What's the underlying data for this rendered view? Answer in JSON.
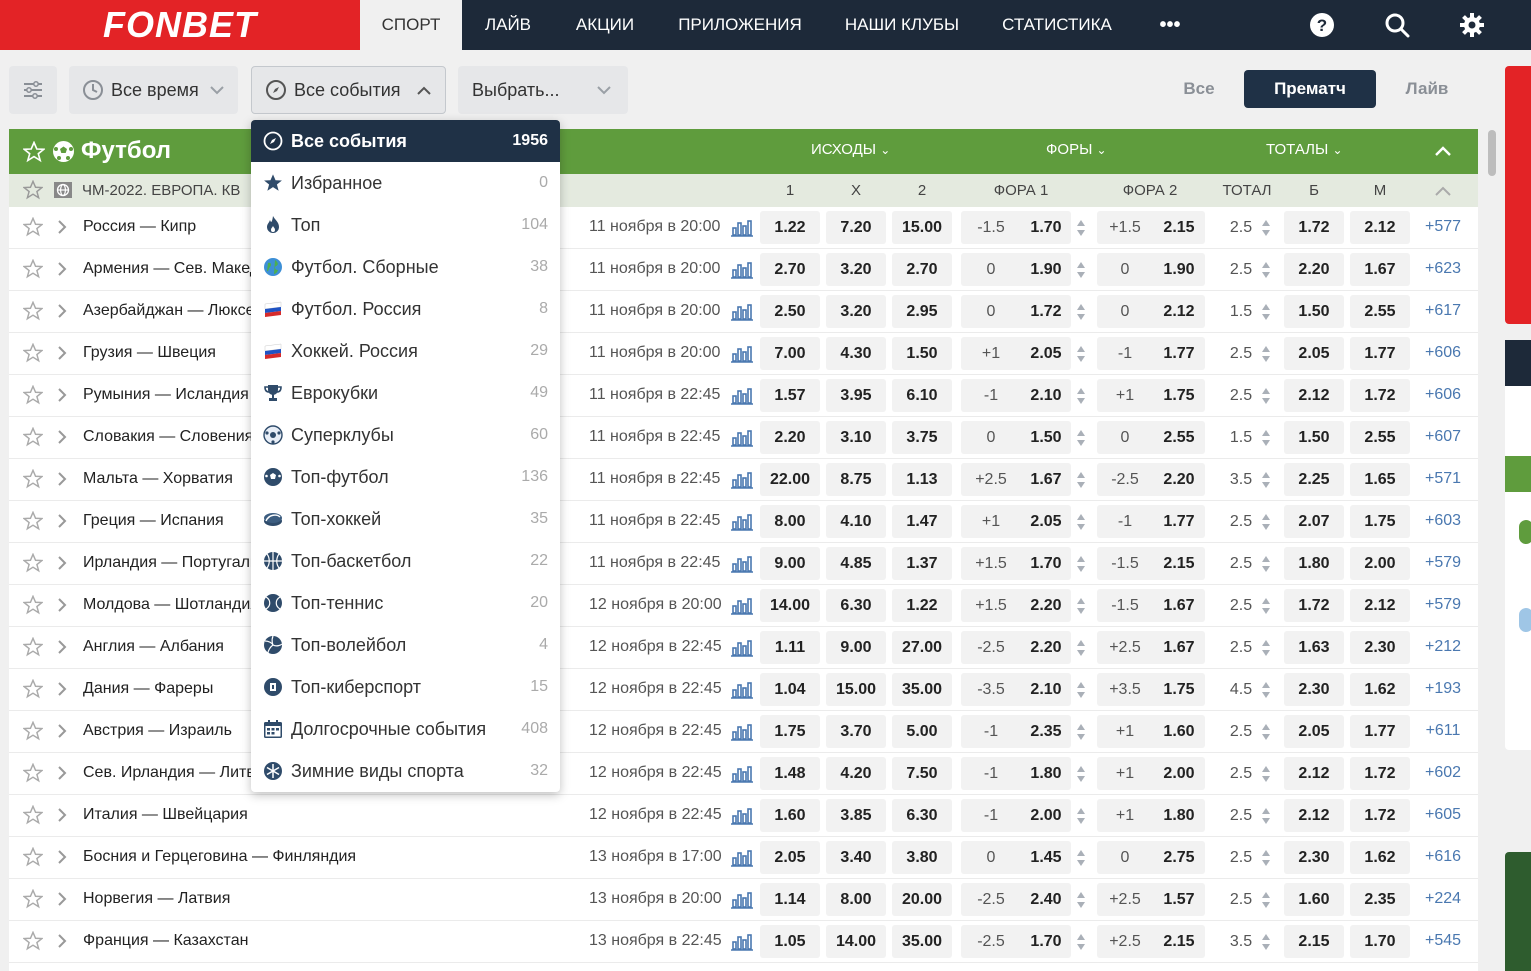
{
  "brand": {
    "logo_text": "FONBET",
    "red": "#e32326",
    "navy": "#1d2939",
    "green": "#5f9c3d"
  },
  "nav": {
    "items": [
      "СПОРТ",
      "ЛАЙВ",
      "АКЦИИ",
      "ПРИЛОЖЕНИЯ",
      "НАШИ КЛУБЫ",
      "СТАТИСТИКА",
      "•••"
    ],
    "icons": [
      "help-icon",
      "search-icon",
      "gear-icon"
    ]
  },
  "filters": {
    "time": "Все время",
    "events": "Все события",
    "select": "Выбрать..."
  },
  "modes": [
    "Все",
    "Прематч",
    "Лайв"
  ],
  "sport": {
    "title": "Футбол",
    "groups": [
      "ИСХОДЫ",
      "ФОРЫ",
      "ТОТАЛЫ"
    ],
    "league": "ЧМ-2022. ЕВРОПА. КВ",
    "columns": [
      "1",
      "Х",
      "2",
      "ФОРА 1",
      "ФОРА 2",
      "ТОТАЛ",
      "Б",
      "М"
    ]
  },
  "events": [
    {
      "name": "Россия — Кипр",
      "date": "11 ноября в 20:00",
      "o1": "1.22",
      "x": "7.20",
      "o2": "15.00",
      "h1": "-1.5",
      "h1o": "1.70",
      "h2": "+1.5",
      "h2o": "2.15",
      "t": "2.5",
      "b": "1.72",
      "m": "2.12",
      "more": "+577"
    },
    {
      "name": "Армения — Сев. Македония",
      "date": "11 ноября в 20:00",
      "o1": "2.70",
      "x": "3.20",
      "o2": "2.70",
      "h1": "0",
      "h1o": "1.90",
      "h2": "0",
      "h2o": "1.90",
      "t": "2.5",
      "b": "2.20",
      "m": "1.67",
      "more": "+623"
    },
    {
      "name": "Азербайджан — Люксембург",
      "date": "11 ноября в 20:00",
      "o1": "2.50",
      "x": "3.20",
      "o2": "2.95",
      "h1": "0",
      "h1o": "1.72",
      "h2": "0",
      "h2o": "2.12",
      "t": "1.5",
      "b": "1.50",
      "m": "2.55",
      "more": "+617"
    },
    {
      "name": "Грузия — Швеция",
      "date": "11 ноября в 20:00",
      "o1": "7.00",
      "x": "4.30",
      "o2": "1.50",
      "h1": "+1",
      "h1o": "2.05",
      "h2": "-1",
      "h2o": "1.77",
      "t": "2.5",
      "b": "2.05",
      "m": "1.77",
      "more": "+606"
    },
    {
      "name": "Румыния — Исландия",
      "date": "11 ноября в 22:45",
      "o1": "1.57",
      "x": "3.95",
      "o2": "6.10",
      "h1": "-1",
      "h1o": "2.10",
      "h2": "+1",
      "h2o": "1.75",
      "t": "2.5",
      "b": "2.12",
      "m": "1.72",
      "more": "+606"
    },
    {
      "name": "Словакия — Словения",
      "date": "11 ноября в 22:45",
      "o1": "2.20",
      "x": "3.10",
      "o2": "3.75",
      "h1": "0",
      "h1o": "1.50",
      "h2": "0",
      "h2o": "2.55",
      "t": "1.5",
      "b": "1.50",
      "m": "2.55",
      "more": "+607"
    },
    {
      "name": "Мальта — Хорватия",
      "date": "11 ноября в 22:45",
      "o1": "22.00",
      "x": "8.75",
      "o2": "1.13",
      "h1": "+2.5",
      "h1o": "1.67",
      "h2": "-2.5",
      "h2o": "2.20",
      "t": "3.5",
      "b": "2.25",
      "m": "1.65",
      "more": "+571"
    },
    {
      "name": "Греция — Испания",
      "date": "11 ноября в 22:45",
      "o1": "8.00",
      "x": "4.10",
      "o2": "1.47",
      "h1": "+1",
      "h1o": "2.05",
      "h2": "-1",
      "h2o": "1.77",
      "t": "2.5",
      "b": "2.07",
      "m": "1.75",
      "more": "+603"
    },
    {
      "name": "Ирландия — Португалия",
      "date": "11 ноября в 22:45",
      "o1": "9.00",
      "x": "4.85",
      "o2": "1.37",
      "h1": "+1.5",
      "h1o": "1.70",
      "h2": "-1.5",
      "h2o": "2.15",
      "t": "2.5",
      "b": "1.80",
      "m": "2.00",
      "more": "+579"
    },
    {
      "name": "Молдова — Шотландия",
      "date": "12 ноября в 20:00",
      "o1": "14.00",
      "x": "6.30",
      "o2": "1.22",
      "h1": "+1.5",
      "h1o": "2.20",
      "h2": "-1.5",
      "h2o": "1.67",
      "t": "2.5",
      "b": "1.72",
      "m": "2.12",
      "more": "+579"
    },
    {
      "name": "Англия — Албания",
      "date": "12 ноября в 22:45",
      "o1": "1.11",
      "x": "9.00",
      "o2": "27.00",
      "h1": "-2.5",
      "h1o": "2.20",
      "h2": "+2.5",
      "h2o": "1.67",
      "t": "2.5",
      "b": "1.63",
      "m": "2.30",
      "more": "+212"
    },
    {
      "name": "Дания — Фареры",
      "date": "12 ноября в 22:45",
      "o1": "1.04",
      "x": "15.00",
      "o2": "35.00",
      "h1": "-3.5",
      "h1o": "2.10",
      "h2": "+3.5",
      "h2o": "1.75",
      "t": "4.5",
      "b": "2.30",
      "m": "1.62",
      "more": "+193"
    },
    {
      "name": "Австрия — Израиль",
      "date": "12 ноября в 22:45",
      "o1": "1.75",
      "x": "3.70",
      "o2": "5.00",
      "h1": "-1",
      "h1o": "2.35",
      "h2": "+1",
      "h2o": "1.60",
      "t": "2.5",
      "b": "2.05",
      "m": "1.77",
      "more": "+611"
    },
    {
      "name": "Сев. Ирландия — Литва",
      "date": "12 ноября в 22:45",
      "o1": "1.48",
      "x": "4.20",
      "o2": "7.50",
      "h1": "-1",
      "h1o": "1.80",
      "h2": "+1",
      "h2o": "2.00",
      "t": "2.5",
      "b": "2.12",
      "m": "1.72",
      "more": "+602"
    },
    {
      "name": "Италия — Швейцария",
      "date": "12 ноября в 22:45",
      "o1": "1.60",
      "x": "3.85",
      "o2": "6.30",
      "h1": "-1",
      "h1o": "2.00",
      "h2": "+1",
      "h2o": "1.80",
      "t": "2.5",
      "b": "2.12",
      "m": "1.72",
      "more": "+605"
    },
    {
      "name": "Босния и Герцеговина — Финляндия",
      "date": "13 ноября в 17:00",
      "o1": "2.05",
      "x": "3.40",
      "o2": "3.80",
      "h1": "0",
      "h1o": "1.45",
      "h2": "0",
      "h2o": "2.75",
      "t": "2.5",
      "b": "2.30",
      "m": "1.62",
      "more": "+616"
    },
    {
      "name": "Норвегия — Латвия",
      "date": "13 ноября в 20:00",
      "o1": "1.14",
      "x": "8.00",
      "o2": "20.00",
      "h1": "-2.5",
      "h1o": "2.40",
      "h2": "+2.5",
      "h2o": "1.57",
      "t": "2.5",
      "b": "1.60",
      "m": "2.35",
      "more": "+224"
    },
    {
      "name": "Франция — Казахстан",
      "date": "13 ноября в 22:45",
      "o1": "1.05",
      "x": "14.00",
      "o2": "35.00",
      "h1": "-2.5",
      "h1o": "1.70",
      "h2": "+2.5",
      "h2o": "2.15",
      "t": "3.5",
      "b": "2.15",
      "m": "1.70",
      "more": "+545"
    }
  ],
  "dropdown": [
    {
      "label": "Все события",
      "count": "1956",
      "icon": "compass-icon"
    },
    {
      "label": "Избранное",
      "count": "0",
      "icon": "star-icon"
    },
    {
      "label": "Топ",
      "count": "104",
      "icon": "fire-icon"
    },
    {
      "label": "Футбол. Сборные",
      "count": "38",
      "icon": "globe-icon"
    },
    {
      "label": "Футбол. Россия",
      "count": "8",
      "icon": "russia-flag-icon"
    },
    {
      "label": "Хоккей. Россия",
      "count": "29",
      "icon": "russia-flag-icon"
    },
    {
      "label": "Еврокубки",
      "count": "49",
      "icon": "trophy-icon"
    },
    {
      "label": "Суперклубы",
      "count": "60",
      "icon": "ball-icon"
    },
    {
      "label": "Топ-футбол",
      "count": "136",
      "icon": "football-icon"
    },
    {
      "label": "Топ-хоккей",
      "count": "35",
      "icon": "puck-icon"
    },
    {
      "label": "Топ-баскетбол",
      "count": "22",
      "icon": "basketball-icon"
    },
    {
      "label": "Топ-теннис",
      "count": "20",
      "icon": "tennis-icon"
    },
    {
      "label": "Топ-волейбол",
      "count": "4",
      "icon": "volleyball-icon"
    },
    {
      "label": "Топ-киберспорт",
      "count": "15",
      "icon": "cybersport-icon"
    },
    {
      "label": "Долгосрочные события",
      "count": "408",
      "icon": "calendar-icon"
    },
    {
      "label": "Зимние виды спорта",
      "count": "32",
      "icon": "snowflake-icon"
    }
  ]
}
